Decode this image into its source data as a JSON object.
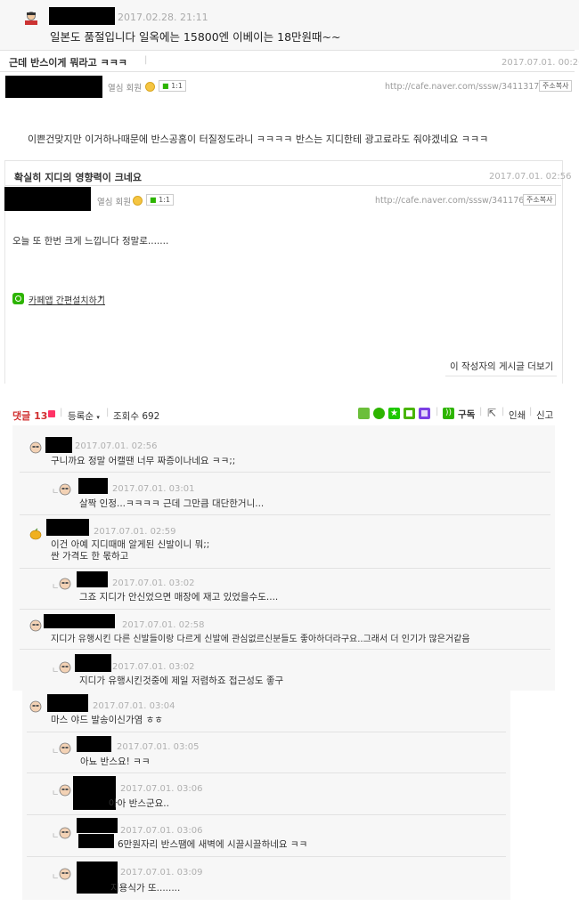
{
  "top_post": {
    "date": "2017.02.28. 21:11",
    "text": "일본도 품절입니다 일옥에는 15800엔 이베이는 18만원때~~"
  },
  "post1": {
    "title": "근데 반스이게 뭐라고 ㅋㅋㅋ",
    "date": "2017.07.01. 00:26",
    "member_label": "열심 회원",
    "talk_label": "1:1",
    "url": "http://cafe.naver.com/sssw/3411317",
    "copy_label": "주소복사",
    "body": "이쁜건맞지만 이거하나때문에 반스공홈이 터질정도라니 ㅋㅋㅋㅋ 반스는 지디한테 광고료라도 줘야겠네요 ㅋㅋㅋ"
  },
  "post2": {
    "title": "확실히 지디의 영향력이 크네요",
    "date": "2017.07.01. 02:56",
    "member_label": "열심 회원",
    "talk_label": "1:1",
    "url": "http://cafe.naver.com/sssw/3411762",
    "copy_label": "주소복사",
    "body": "오늘 또 한번 크게 느낍니다 정말로.......",
    "app_link": "카페앱 간편설치하기",
    "more_posts": "이 작성자의 게시글 더보기"
  },
  "comment_bar": {
    "comments_label": "댓글",
    "comments_count": "13",
    "sort_label": "등록순",
    "views_label": "조회수 692",
    "subscribe_label": "구독",
    "print_label": "인쇄",
    "report_label": "신고"
  },
  "comments": [
    {
      "date": "2017.07.01. 02:56",
      "text": "구니까요 정말 어캘땐 너무 짜증이나네요 ㅋㅋ;;"
    },
    {
      "date": "2017.07.01. 03:01",
      "text": "살짝 인정...ㅋㅋㅋㅋ 근데 그만큼 대단한거니..."
    },
    {
      "date": "2017.07.01. 02:59",
      "text": "이건 아예 지디때매 알게된 신발이니 뭐;;",
      "text2": "싼 가격도 한 몫하고"
    },
    {
      "date": "2017.07.01. 03:02",
      "text": "그죠 지디가 안신었으면 매장에 재고 있었을수도...."
    },
    {
      "date": "2017.07.01. 02:58",
      "text": "지디가 유행시킨 다른 신발들이랑 다르게 신발에 관심없르신분들도 좋아하더라구요..그래서 더 인기가 많은거같음"
    },
    {
      "date": "2017.07.01. 03:02",
      "text": "지디가 유행시킨것중에 제일 저렴하죠 접근성도 좋구"
    },
    {
      "date": "2017.07.01. 03:04",
      "text": "마스 야드 발송이신가염 ㅎㅎ"
    },
    {
      "date": "2017.07.01. 03:05",
      "text": "아뇨 반스요! ㅋㅋ"
    },
    {
      "date": "2017.07.01. 03:06",
      "text": "아아 반스군요.."
    },
    {
      "date": "2017.07.01. 03:06",
      "text": "6만원자리 반스땜에 새벽에 시끌시끌하네요 ㅋㅋ"
    },
    {
      "date": "2017.07.01. 03:09",
      "text": "지용식가 또........"
    }
  ],
  "reply_mark": "ㄴ"
}
